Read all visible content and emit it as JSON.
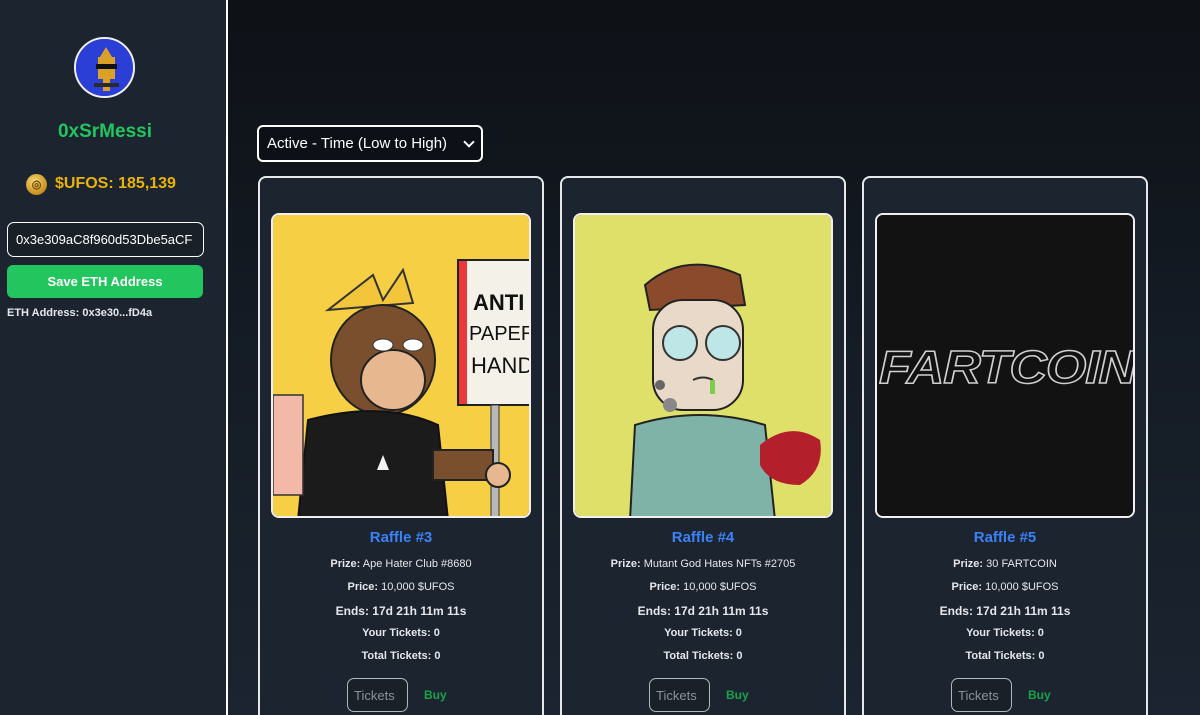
{
  "profile": {
    "username": "0xSrMessi",
    "balance_label": "$UFOS: 185,139",
    "eth_input_value": "0x3e309aC8f960d53Dbe5aCF",
    "save_button": "Save ETH Address",
    "eth_address_label": "ETH Address:",
    "eth_address_short": "0x3e30...fD4a"
  },
  "sort": {
    "selected": "Active - Time (Low to High)"
  },
  "raffles": [
    {
      "title": "Raffle #3",
      "prize_label": "Prize:",
      "prize": "Ape Hater Club #8680",
      "price_label": "Price:",
      "price": "10,000 $UFOS",
      "ends_label": "Ends:",
      "ends": "17d 21h 11m 11s",
      "your_label": "Your Tickets:",
      "your": "0",
      "total_label": "Total Tickets:",
      "total": "0",
      "ticket_placeholder": "Tickets",
      "buy": "Buy",
      "sign_text": [
        "ANTI",
        "PAPER",
        "HAND"
      ]
    },
    {
      "title": "Raffle #4",
      "prize_label": "Prize:",
      "prize": "Mutant God Hates NFTs #2705",
      "price_label": "Price:",
      "price": "10,000 $UFOS",
      "ends_label": "Ends:",
      "ends": "17d 21h 11m 11s",
      "your_label": "Your Tickets:",
      "your": "0",
      "total_label": "Total Tickets:",
      "total": "0",
      "ticket_placeholder": "Tickets",
      "buy": "Buy"
    },
    {
      "title": "Raffle #5",
      "prize_label": "Prize:",
      "prize": "30 FARTCOIN",
      "price_label": "Price:",
      "price": "10,000 $UFOS",
      "ends_label": "Ends:",
      "ends": "17d 21h 11m 11s",
      "your_label": "Your Tickets:",
      "your": "0",
      "total_label": "Total Tickets:",
      "total": "0",
      "ticket_placeholder": "Tickets",
      "buy": "Buy",
      "logo_text": "FARTCOIN"
    }
  ],
  "colors": {
    "username": "#22c55e",
    "balance": "#eab308",
    "save_button_bg": "#22c55e",
    "raffle_title": "#3b82f6",
    "buy": "#16a34a"
  },
  "icons": [
    "coin-icon",
    "chevron-down-icon"
  ]
}
